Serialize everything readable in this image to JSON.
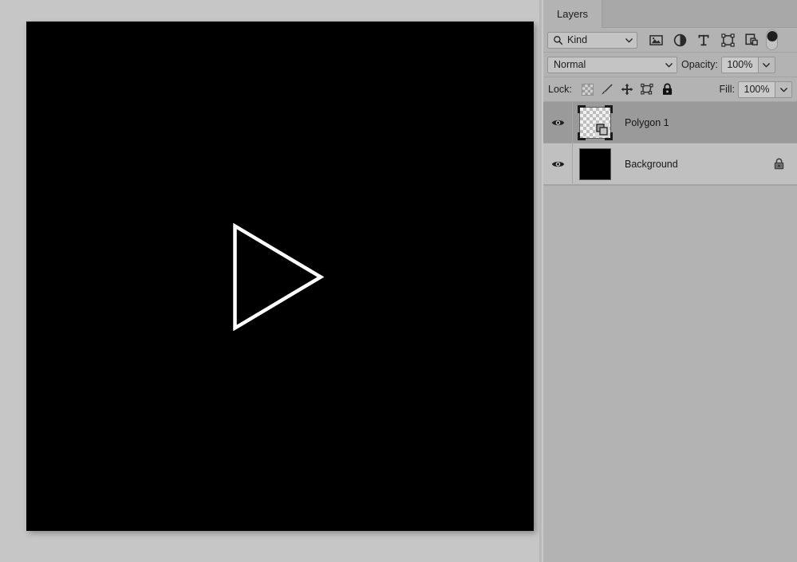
{
  "document": {
    "canvas": {
      "background_color": "#000000",
      "shape": {
        "name": "triangle-play-shape",
        "stroke_color": "#ffffff",
        "fill": "none",
        "stroke_width": "4"
      }
    }
  },
  "panel": {
    "tabs": [
      {
        "label": "Layers",
        "active": true
      }
    ],
    "filter_row": {
      "search_icon": "search-icon",
      "kind_label": "Kind",
      "chevron": "chevron-down-icon",
      "icons": [
        {
          "name": "pixel-layer-filter-icon",
          "title": "Filter for pixel layers"
        },
        {
          "name": "adjustment-layer-filter-icon",
          "title": "Filter for adjustment layers"
        },
        {
          "name": "type-layer-filter-icon",
          "title": "Filter for type layers"
        },
        {
          "name": "shape-layer-filter-icon",
          "title": "Filter for shape layers"
        },
        {
          "name": "smart-object-filter-icon",
          "title": "Filter for smart objects"
        }
      ],
      "toggle": {
        "name": "filter-enable-toggle",
        "state": "on"
      }
    },
    "blend_row": {
      "blend_mode": "Normal",
      "blend_chevron": "chevron-down-icon",
      "opacity_label": "Opacity:",
      "opacity_value": "100%",
      "opacity_chevron": "chevron-down-icon"
    },
    "lock_row": {
      "lock_label": "Lock:",
      "icons": [
        {
          "name": "lock-transparent-pixels-icon",
          "active": false
        },
        {
          "name": "lock-image-pixels-brush-icon",
          "active": false
        },
        {
          "name": "lock-position-move-icon",
          "active": false
        },
        {
          "name": "lock-artboard-nesting-icon",
          "active": false
        },
        {
          "name": "lock-all-padlock-icon",
          "active": true
        }
      ],
      "fill_label": "Fill:",
      "fill_value": "100%",
      "fill_chevron": "chevron-down-icon"
    },
    "layers": [
      {
        "name": "Polygon 1",
        "visible": true,
        "selected": true,
        "thumbnail_type": "transparent-checker",
        "badge": "vector-shape-badge-icon",
        "locked": false
      },
      {
        "name": "Background",
        "visible": true,
        "selected": false,
        "thumbnail_type": "solid-black",
        "badge": null,
        "locked": true,
        "lock_icon": "padlock-icon"
      }
    ]
  },
  "colors": {
    "panel_background": "#b3b3b3",
    "tab_bar_background": "#a8a8a8",
    "layer_row": "#c0c0c0",
    "layer_row_selected": "#9a9a9a",
    "workspace_background": "#c6c6c6",
    "canvas_black": "#000000",
    "shape_stroke": "#ffffff"
  }
}
